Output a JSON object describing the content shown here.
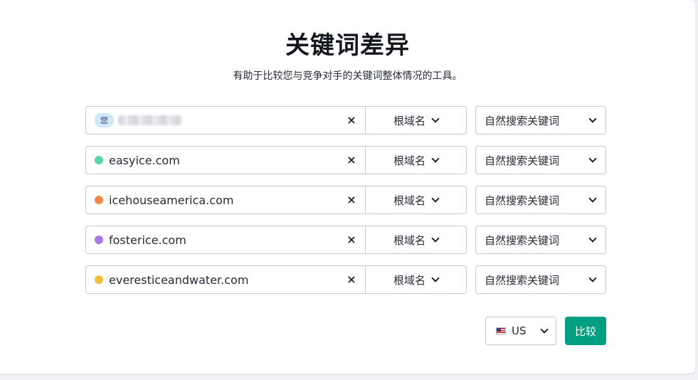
{
  "header": {
    "title": "关键词差异",
    "subtitle": "有助于比较您与竞争对手的关键词整体情况的工具。"
  },
  "rows": [
    {
      "badge": "您",
      "domain": "",
      "dot_color": "",
      "scope": "根域名",
      "type": "自然搜索关键词"
    },
    {
      "badge": "",
      "domain": "easyice.com",
      "dot_color": "#5ed3a4",
      "scope": "根域名",
      "type": "自然搜索关键词"
    },
    {
      "badge": "",
      "domain": "icehouseamerica.com",
      "dot_color": "#f08a4b",
      "scope": "根域名",
      "type": "自然搜索关键词"
    },
    {
      "badge": "",
      "domain": "fosterice.com",
      "dot_color": "#a876ea",
      "scope": "根域名",
      "type": "自然搜索关键词"
    },
    {
      "badge": "",
      "domain": "everesticeandwater.com",
      "dot_color": "#f5be3d",
      "scope": "根域名",
      "type": "自然搜索关键词"
    }
  ],
  "icons": {
    "clear": "×",
    "chevron": "chevron-down-icon",
    "flag": "us-flag-icon"
  },
  "footer": {
    "database": "US",
    "compare_label": "比较"
  },
  "colors": {
    "accent": "#009f81",
    "border": "#c7c9d1"
  }
}
